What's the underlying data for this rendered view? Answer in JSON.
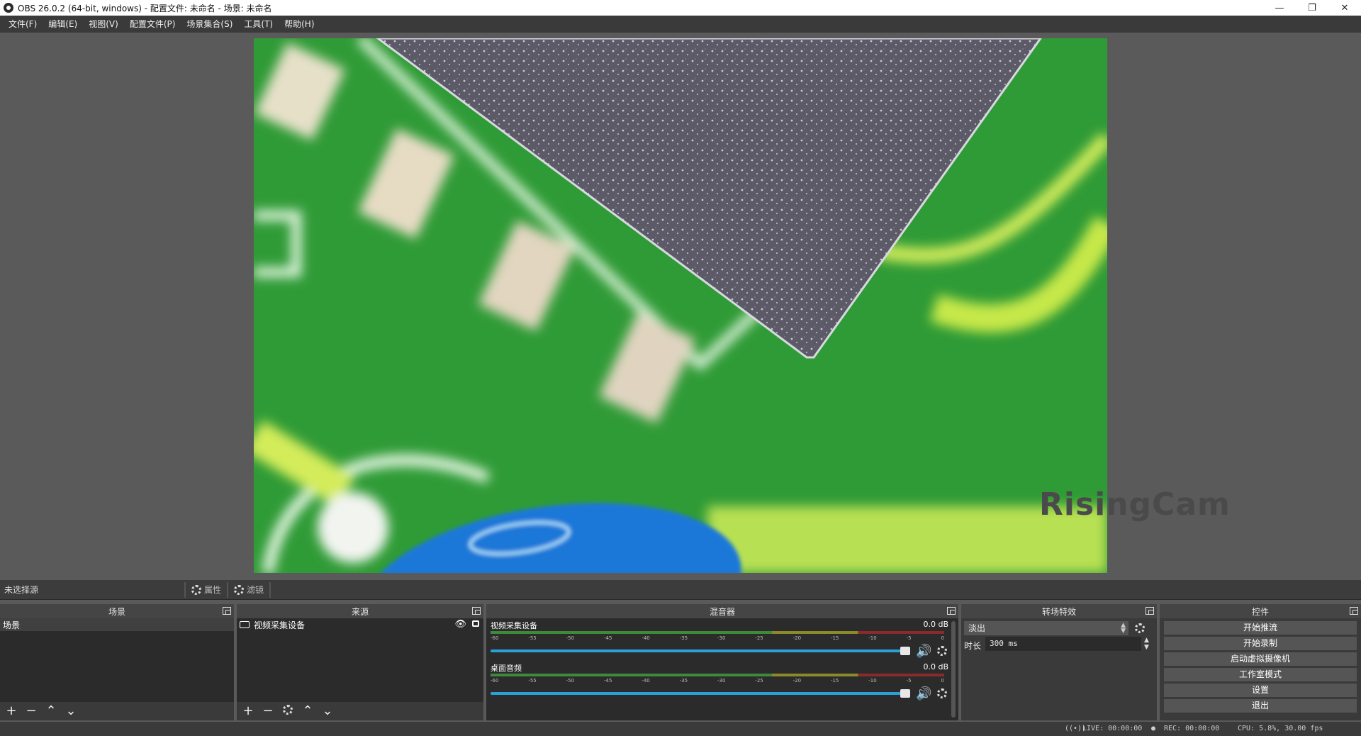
{
  "window": {
    "title": "OBS 26.0.2 (64-bit, windows) - 配置文件: 未命名 - 场景: 未命名",
    "minimize": "—",
    "restore": "❐",
    "close": "✕"
  },
  "menu": [
    "文件(F)",
    "编辑(E)",
    "视图(V)",
    "配置文件(P)",
    "场景集合(S)",
    "工具(T)",
    "帮助(H)"
  ],
  "preview": {
    "watermark": "RisingCam"
  },
  "source_toolbar": {
    "no_source": "未选择源",
    "properties": "属性",
    "filters": "滤镜"
  },
  "scenes": {
    "title": "场景",
    "items": [
      "场景"
    ]
  },
  "sources": {
    "title": "来源",
    "items": [
      "视频采集设备"
    ]
  },
  "mixer": {
    "title": "混音器",
    "ticks": [
      "-60",
      "-55",
      "-50",
      "-45",
      "-40",
      "-35",
      "-30",
      "-25",
      "-20",
      "-15",
      "-10",
      "-5",
      "0"
    ],
    "channels": [
      {
        "name": "视频采集设备",
        "db": "0.0 dB",
        "volume": 1.0
      },
      {
        "name": "桌面音频",
        "db": "0.0 dB",
        "volume": 1.0
      }
    ]
  },
  "transitions": {
    "title": "转场特效",
    "selected": "淡出",
    "duration_label": "时长",
    "duration_value": "300 ms"
  },
  "controls": {
    "title": "控件",
    "buttons": [
      "开始推流",
      "开始录制",
      "启动虚拟摄像机",
      "工作室模式",
      "设置",
      "退出"
    ]
  },
  "status": {
    "live": "LIVE: 00:00:00",
    "rec": "REC: 00:00:00",
    "cpu": "CPU: 5.8%, 30.00 fps"
  },
  "colors": {
    "accent_fader": "#2aa0d8",
    "panel": "#2b2b2b",
    "dock_header": "#454545"
  }
}
